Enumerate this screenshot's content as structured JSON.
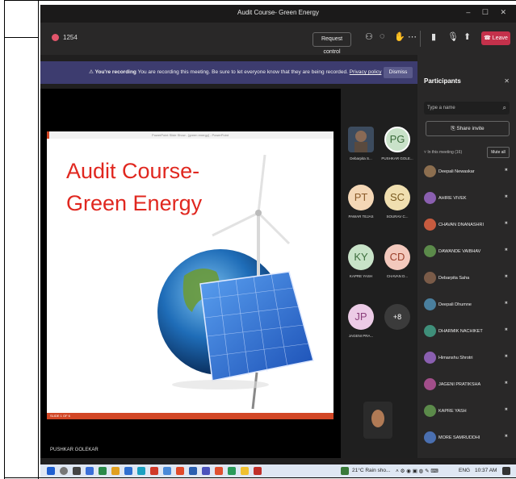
{
  "window": {
    "title": "Audit Course- Green Energy",
    "controls": "– ☐ ✕"
  },
  "toolbar": {
    "timer": "1254",
    "request_control": "Request control",
    "leave": "Leave"
  },
  "banner": {
    "bold": "You're recording",
    "text": "You are recording this meeting. Be sure to let everyone know that they are being recorded.",
    "privacy": "Privacy policy",
    "dismiss": "Dismiss"
  },
  "slide": {
    "app_title": "PowerPoint Slide Show - [green energy] - PowerPoint",
    "heading": "Audit Course- Green Energy",
    "status": "SLIDE 1 OF 6",
    "presenter": "PUSHKAR GOLEKAR"
  },
  "gallery": [
    {
      "initials": "",
      "name": "Debarpita S..."
    },
    {
      "initials": "PG",
      "name": "PUSHKAR GOLE..."
    },
    {
      "initials": "PT",
      "name": "PAWAR TEJAS"
    },
    {
      "initials": "SC",
      "name": "SOURAV C..."
    },
    {
      "initials": "KY",
      "name": "KAPRE YASH"
    },
    {
      "initials": "CD",
      "name": "CHAVAN D..."
    },
    {
      "initials": "JP",
      "name": "JAGENI PRA..."
    },
    {
      "initials": "+8",
      "name": ""
    }
  ],
  "panel": {
    "title": "Participants",
    "search_placeholder": "Type a name",
    "share_invite": "Share invite",
    "in_meeting": "In this meeting (16)",
    "mute_all": "Mute all",
    "people": [
      {
        "name": "Deepali Newaskar",
        "color": "#8c6e4f"
      },
      {
        "name": "AHIRE VIVEK",
        "color": "#8a5fb0"
      },
      {
        "name": "CHAVAN DNANASHRI",
        "color": "#c75b3f"
      },
      {
        "name": "DAWANDE VAIBHAV",
        "color": "#5b8a4a"
      },
      {
        "name": "Debarpita Saha",
        "color": "#7a5b48"
      },
      {
        "name": "Deepali Dhumne",
        "color": "#4a7f9e"
      },
      {
        "name": "DHARMIK NACHIKET",
        "color": "#3f8f7a"
      },
      {
        "name": "Himanshu Shrotri",
        "color": "#8a5fb0"
      },
      {
        "name": "JAGENI PRATIKSHA",
        "color": "#a24e8a"
      },
      {
        "name": "KAPRE YASH",
        "color": "#5b8a4a"
      },
      {
        "name": "MORE SAMRUDDHI",
        "color": "#4a6fb0"
      }
    ]
  },
  "taskbar": {
    "weather": "21°C Rain sho...",
    "lang": "ENG",
    "time": "10:37 AM"
  },
  "colors": {
    "accent": "#6264a7",
    "leave": "#c4314b",
    "slide_title": "#e0271f"
  }
}
